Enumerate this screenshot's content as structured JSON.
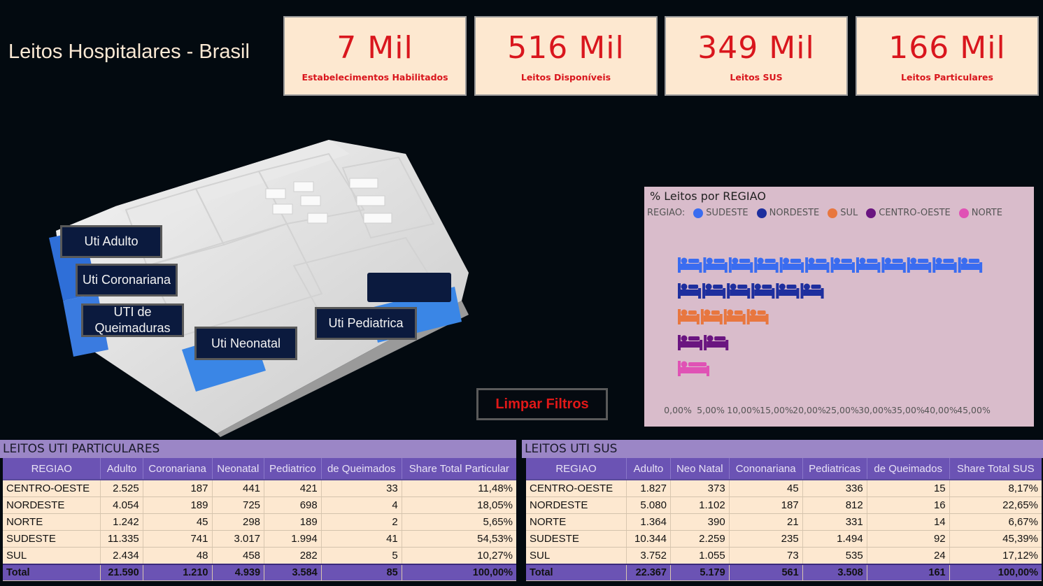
{
  "title": "Leitos Hospitalares - Brasil",
  "kpis": [
    {
      "value": "7 Mil",
      "label": "Estabelecimentos Habilitados"
    },
    {
      "value": "516 Mil",
      "label": "Leitos Disponíveis"
    },
    {
      "value": "349 Mil",
      "label": "Leitos SUS"
    },
    {
      "value": "166 Mil",
      "label": "Leitos Particulares"
    }
  ],
  "plan_buttons": {
    "adulto": "Uti Adulto",
    "coronariana": "Uti Coronariana",
    "queimaduras_1": "UTI de",
    "queimaduras_2": "Queimaduras",
    "neonatal": "Uti Neonatal",
    "pediatrica": "Uti Pediatrica"
  },
  "clear_filters": "Limpar Filtros",
  "chart_data": {
    "type": "bar",
    "title": "% Leitos por REGIAO",
    "legend_title": "REGIAO:",
    "legend_position": "top-left",
    "orientation": "horizontal",
    "unit": "bed-icon pictogram, each icon ≈ 4%",
    "categories": [
      "SUDESTE",
      "NORDESTE",
      "SUL",
      "CENTRO-OESTE",
      "NORTE"
    ],
    "values": [
      46.5,
      22.4,
      14.0,
      7.9,
      5.0
    ],
    "colors": [
      "#3a6cf0",
      "#1e2f9e",
      "#e8773f",
      "#6a1580",
      "#e052b5"
    ],
    "xlim": [
      0,
      45
    ],
    "xticks": [
      "0,00%",
      "5,00%",
      "10,00%",
      "15,00%",
      "20,00%",
      "25,00%",
      "30,00%",
      "35,00%",
      "40,00%",
      "45,00%"
    ],
    "grid": false
  },
  "table_particular": {
    "title": "LEITOS UTI PARTICULARES",
    "headers": [
      "REGIAO",
      "Adulto",
      "Coronariana",
      "Neonatal",
      "Pediatrico",
      "de Queimados",
      "Share Total Particular"
    ],
    "rows": [
      [
        "CENTRO-OESTE",
        "2.525",
        "187",
        "441",
        "421",
        "33",
        "11,48%"
      ],
      [
        "NORDESTE",
        "4.054",
        "189",
        "725",
        "698",
        "4",
        "18,05%"
      ],
      [
        "NORTE",
        "1.242",
        "45",
        "298",
        "189",
        "2",
        "5,65%"
      ],
      [
        "SUDESTE",
        "11.335",
        "741",
        "3.017",
        "1.994",
        "41",
        "54,53%"
      ],
      [
        "SUL",
        "2.434",
        "48",
        "458",
        "282",
        "5",
        "10,27%"
      ]
    ],
    "total": [
      "Total",
      "21.590",
      "1.210",
      "4.939",
      "3.584",
      "85",
      "100,00%"
    ]
  },
  "table_sus": {
    "title": "LEITOS UTI SUS",
    "headers": [
      "REGIAO",
      "Adulto",
      "Neo Natal",
      "Cononariana",
      "Pediatricas",
      "de Queimados",
      "Share Total SUS"
    ],
    "rows": [
      [
        "CENTRO-OESTE",
        "1.827",
        "373",
        "45",
        "336",
        "15",
        "8,17%"
      ],
      [
        "NORDESTE",
        "5.080",
        "1.102",
        "187",
        "812",
        "16",
        "22,65%"
      ],
      [
        "NORTE",
        "1.364",
        "390",
        "21",
        "331",
        "14",
        "6,67%"
      ],
      [
        "SUDESTE",
        "10.344",
        "2.259",
        "235",
        "1.494",
        "92",
        "45,39%"
      ],
      [
        "SUL",
        "3.752",
        "1.055",
        "73",
        "535",
        "24",
        "17,12%"
      ]
    ],
    "total": [
      "Total",
      "22.367",
      "5.179",
      "561",
      "3.508",
      "161",
      "100,00%"
    ]
  }
}
